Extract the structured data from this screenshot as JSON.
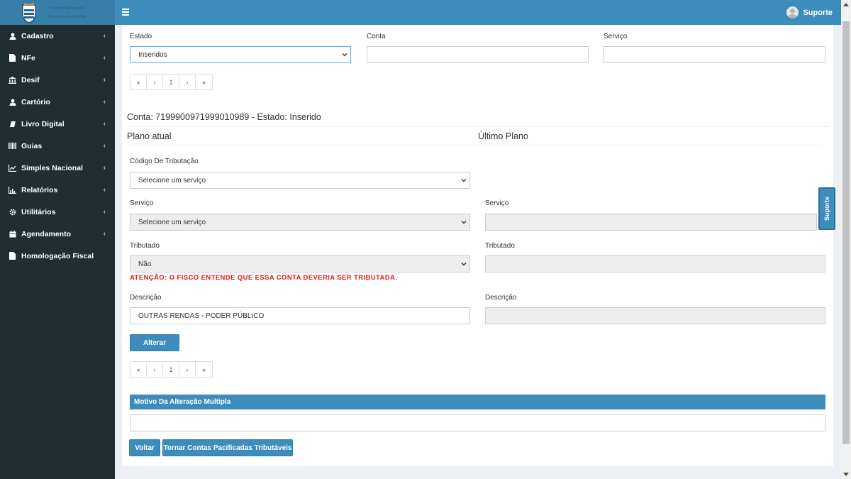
{
  "logo": {
    "line1": "Prefeitura Municipal",
    "line2": "—",
    "line3": "Secretaria da Fazenda"
  },
  "sidebar": {
    "items": [
      {
        "label": "Cadastro",
        "icon": "user-icon",
        "chevron": "‹"
      },
      {
        "label": "NFe",
        "icon": "file-icon",
        "chevron": "‹"
      },
      {
        "label": "Desif",
        "icon": "bank-icon",
        "chevron": "‹"
      },
      {
        "label": "Cartório",
        "icon": "user-icon",
        "chevron": "‹"
      },
      {
        "label": "Livro Digital",
        "icon": "book-icon",
        "chevron": "‹"
      },
      {
        "label": "Guias",
        "icon": "barcode-icon",
        "chevron": "‹"
      },
      {
        "label": "Simples Nacional",
        "icon": "line-chart-icon",
        "chevron": "‹"
      },
      {
        "label": "Relatórios",
        "icon": "bar-chart-icon",
        "chevron": "‹"
      },
      {
        "label": "Utilitários",
        "icon": "cog-icon",
        "chevron": "‹"
      },
      {
        "label": "Agendamento",
        "icon": "calendar-icon",
        "chevron": "‹"
      },
      {
        "label": "Homologação Fiscal",
        "icon": "file-icon",
        "chevron": ""
      }
    ]
  },
  "topbar": {
    "user_label": "Suporte"
  },
  "filters": {
    "estado_label": "Estado",
    "estado_value": "Inseridos",
    "conta_label": "Conta",
    "conta_value": "",
    "servico_label": "Serviço",
    "servico_value": ""
  },
  "pager": {
    "first": "«",
    "prev": "‹",
    "page": "1",
    "next": "›",
    "last": "»"
  },
  "account": {
    "title": "Conta: 7199900971999010989 - Estado: Inserido",
    "plano_atual": "Plano atual",
    "ultimo_plano": "Último Plano"
  },
  "form": {
    "codigo_label": "Código De Tributação",
    "codigo_value": "Selecione um serviço",
    "servico_label": "Serviço",
    "servico_value": "Selecione um serviço",
    "servico_right_label": "Serviço",
    "servico_right_value": "",
    "tributado_label": "Tributado",
    "tributado_value": "Não",
    "tributado_right_label": "Tributado",
    "tributado_right_value": "",
    "warning": "ATENÇÃO: O FISCO ENTENDE QUE ESSA CONTA DEVERIA SER TRIBUTADA.",
    "descricao_label": "Descrição",
    "descricao_value": "OUTRAS RENDAS - PODER PÚBLICO",
    "descricao_right_label": "Descrição",
    "descricao_right_value": "",
    "alterar_button": "Alterar"
  },
  "motivo": {
    "title": "Motivo Da Alteração Multipla",
    "value": ""
  },
  "actions": {
    "voltar": "Voltar",
    "tornar": "Tornar Contas Pacificadas Tributáveis"
  },
  "support_tab": "Suporte",
  "colors": {
    "sidebar_bg": "#222d32",
    "topbar_bg": "#3c8dbc",
    "accent": "#3c8dbc",
    "warning": "#dd1a1a"
  }
}
